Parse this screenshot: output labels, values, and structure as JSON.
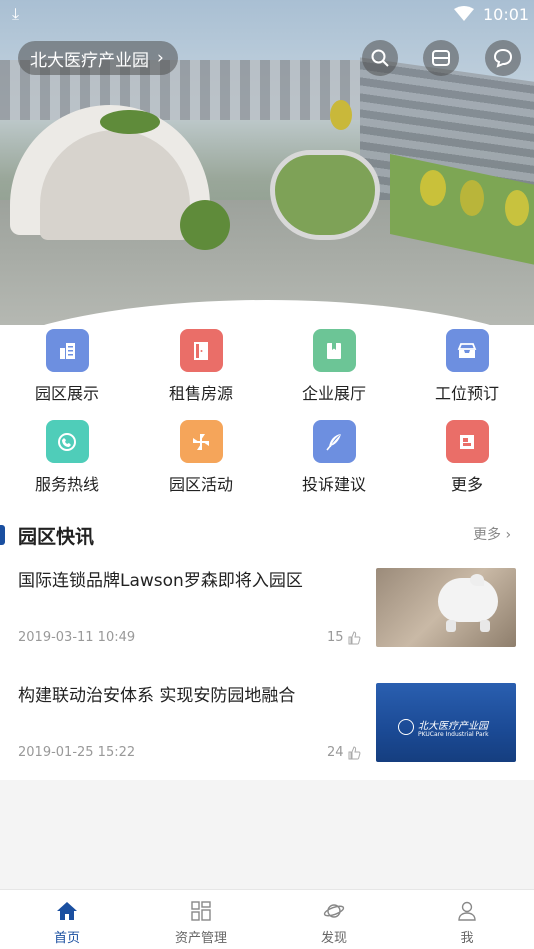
{
  "status_bar": {
    "time": "10:01"
  },
  "header": {
    "location": "北大医疗产业园"
  },
  "grid": [
    {
      "label": "园区展示",
      "icon": "building-list-icon",
      "color": "#6d8fe0"
    },
    {
      "label": "租售房源",
      "icon": "door-icon",
      "color": "#ea6e68"
    },
    {
      "label": "企业展厅",
      "icon": "bookmark-book-icon",
      "color": "#6cc596"
    },
    {
      "label": "工位预订",
      "icon": "inbox-tray-icon",
      "color": "#6d8fe0"
    },
    {
      "label": "服务热线",
      "icon": "phone-icon",
      "color": "#4fcdb9"
    },
    {
      "label": "园区活动",
      "icon": "pinwheel-icon",
      "color": "#f5a55a"
    },
    {
      "label": "投诉建议",
      "icon": "feather-icon",
      "color": "#6d8fe0"
    },
    {
      "label": "更多",
      "icon": "more-grid-icon",
      "color": "#ea6e68"
    }
  ],
  "news": {
    "title": "园区快讯",
    "more": "更多",
    "items": [
      {
        "title": "国际连锁品牌Lawson罗森即将入园区",
        "date": "2019-03-11 10:49",
        "likes": "15"
      },
      {
        "title": "构建联动治安体系 实现安防园地融合",
        "date": "2019-01-25 15:22",
        "likes": "24",
        "thumb_cn": "北大医疗产业园",
        "thumb_en": "PKUCare Industrial Park"
      }
    ]
  },
  "bottom_nav": [
    {
      "label": "首页",
      "icon": "home-icon",
      "active": true
    },
    {
      "label": "资产管理",
      "icon": "asset-grid-icon",
      "active": false
    },
    {
      "label": "发现",
      "icon": "planet-icon",
      "active": false
    },
    {
      "label": "我",
      "icon": "user-icon",
      "active": false
    }
  ],
  "colors": {
    "accent": "#1a4fa0"
  }
}
